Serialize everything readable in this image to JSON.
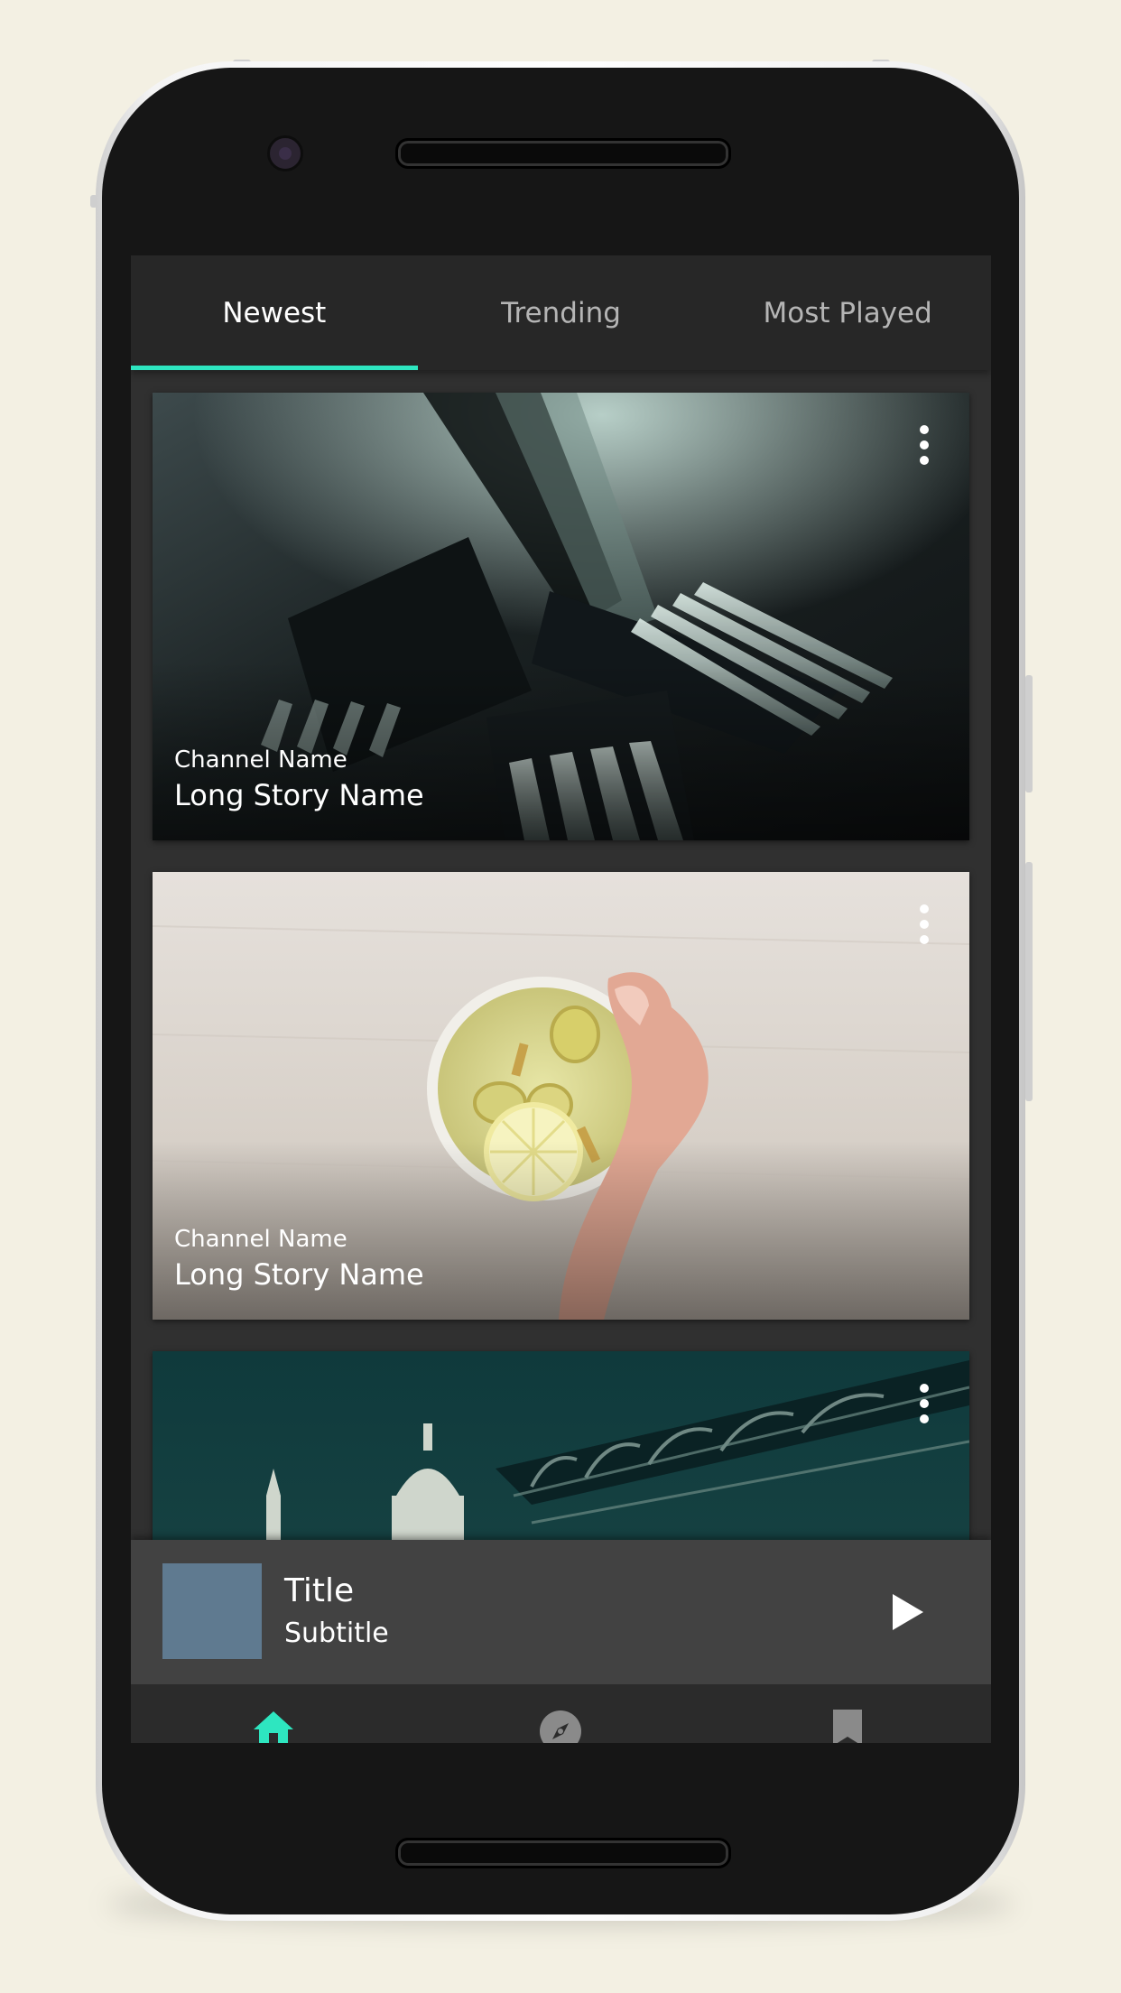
{
  "tabs": [
    {
      "label": "Newest"
    },
    {
      "label": "Trending"
    },
    {
      "label": "Most Played"
    }
  ],
  "active_tab_index": 0,
  "cards": [
    {
      "channel": "Channel Name",
      "story": "Long Story Name",
      "image": "forks-photo"
    },
    {
      "channel": "Channel Name",
      "story": "Long Story Name",
      "image": "lemon-tea-photo"
    },
    {
      "image": "city-bridge-photo"
    }
  ],
  "player": {
    "title": "Title",
    "subtitle": "Subtitle",
    "thumb_color": "#5f7a90",
    "play_icon": "play-icon"
  },
  "bottom_nav": [
    {
      "icon": "home-icon",
      "active": true
    },
    {
      "icon": "compass-icon",
      "active": false
    },
    {
      "icon": "bookmark-icon",
      "active": false
    }
  ],
  "colors": {
    "accent": "#2ee6c0",
    "background": "#f3f0e3",
    "screen": "#303030",
    "tabbar": "#272727",
    "player": "#424242"
  }
}
